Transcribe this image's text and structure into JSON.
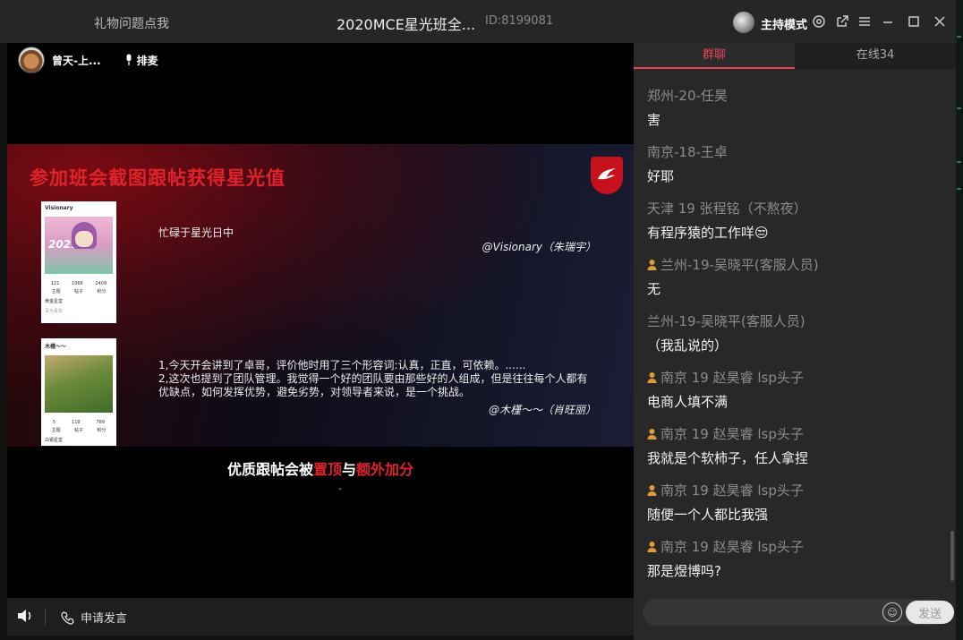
{
  "titlebar": {
    "left_label": "礼物问题点我",
    "room_title": "2020MCE星光班全...",
    "room_id": "ID:8199081",
    "mode_label": "主持模式",
    "icons": [
      "settings-icon",
      "share-icon",
      "menu-icon",
      "minimize-icon",
      "maximize-icon",
      "close-icon"
    ]
  },
  "host": {
    "name": "曾天-上...",
    "mic_label": "排麦"
  },
  "slide": {
    "title": "参加班会截图跟帖获得星光值",
    "card1": {
      "header": "Visionary",
      "badge": "2021",
      "stats": [
        "121",
        "1066",
        "2409"
      ],
      "stat_labels": [
        "主题",
        "帖子",
        "积分"
      ],
      "level": "黄金星堂",
      "tag": "青为青年"
    },
    "card2": {
      "header": "木槿～～",
      "stats": [
        "5",
        "118",
        "789"
      ],
      "stat_labels": [
        "主题",
        "帖子",
        "积分"
      ],
      "level": "白银星堂"
    },
    "quote1": "忙碌于星光日中",
    "sig1": "@Visionary（朱瑞宇）",
    "quote2": "1,今天开会讲到了卓哥，评价他时用了三个形容词:认真，正直，可依赖。......\n2,这次也提到了团队管理。我觉得一个好的团队要由那些好的人组成，但是往往每个人都有优缺点，如何发挥优势，避免劣势，对领导者来说，是一个挑战。",
    "sig2": "@木槿～～（肖旺丽）",
    "caption": {
      "part1": "优质跟帖会被",
      "part2": "置顶",
      "part3": "与",
      "part4": "额外加分"
    },
    "page_marker": "-"
  },
  "videobar": {
    "apply_label": "申请发言"
  },
  "chat": {
    "tabs": [
      {
        "label": "群聊",
        "active": true
      },
      {
        "label": "在线34",
        "active": false
      }
    ],
    "messages": [
      {
        "name": "郑州-20-任昊",
        "text": "害",
        "admin": false
      },
      {
        "name": "南京-18-王卓",
        "text": "好耶",
        "admin": false
      },
      {
        "name": "天津 19 张程铭（不熬夜）",
        "text": "有程序猿的工作咩😒",
        "admin": false
      },
      {
        "name": "兰州-19-吴晓平(客服人员)",
        "text": "无",
        "admin": true
      },
      {
        "name": "兰州-19-吴晓平(客服人员)",
        "text": "（我乱说的）",
        "admin": false
      },
      {
        "name": "南京 19 赵昊睿 lsp头子",
        "text": "电商人填不满",
        "admin": true
      },
      {
        "name": "南京 19 赵昊睿 lsp头子",
        "text": "我就是个软柿子，任人拿捏",
        "admin": true
      },
      {
        "name": "南京 19 赵昊睿 lsp头子",
        "text": "随便一个人都比我强",
        "admin": true
      },
      {
        "name": "南京 19 赵昊睿 lsp头子",
        "text": "那是煜博吗?",
        "admin": true
      }
    ],
    "input": {
      "placeholder": "",
      "send_label": "发送"
    }
  },
  "colors": {
    "accent": "#e8455a",
    "slide_red": "#e0222c",
    "admin_icon": "#e09a3a"
  }
}
